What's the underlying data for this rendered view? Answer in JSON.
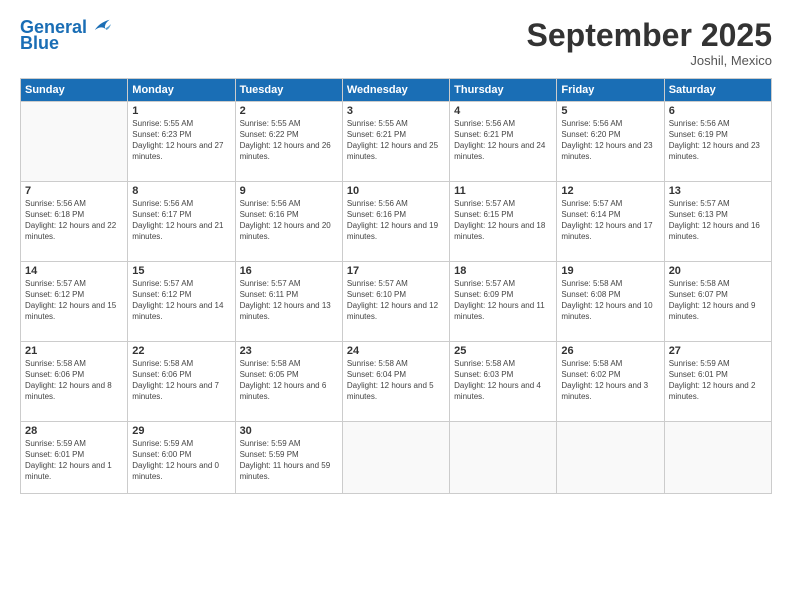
{
  "logo": {
    "text1": "General",
    "text2": "Blue"
  },
  "title": "September 2025",
  "location": "Joshil, Mexico",
  "days_header": [
    "Sunday",
    "Monday",
    "Tuesday",
    "Wednesday",
    "Thursday",
    "Friday",
    "Saturday"
  ],
  "weeks": [
    [
      {
        "day": "",
        "empty": true
      },
      {
        "day": "1",
        "sunrise": "Sunrise: 5:55 AM",
        "sunset": "Sunset: 6:23 PM",
        "daylight": "Daylight: 12 hours and 27 minutes."
      },
      {
        "day": "2",
        "sunrise": "Sunrise: 5:55 AM",
        "sunset": "Sunset: 6:22 PM",
        "daylight": "Daylight: 12 hours and 26 minutes."
      },
      {
        "day": "3",
        "sunrise": "Sunrise: 5:55 AM",
        "sunset": "Sunset: 6:21 PM",
        "daylight": "Daylight: 12 hours and 25 minutes."
      },
      {
        "day": "4",
        "sunrise": "Sunrise: 5:56 AM",
        "sunset": "Sunset: 6:21 PM",
        "daylight": "Daylight: 12 hours and 24 minutes."
      },
      {
        "day": "5",
        "sunrise": "Sunrise: 5:56 AM",
        "sunset": "Sunset: 6:20 PM",
        "daylight": "Daylight: 12 hours and 23 minutes."
      },
      {
        "day": "6",
        "sunrise": "Sunrise: 5:56 AM",
        "sunset": "Sunset: 6:19 PM",
        "daylight": "Daylight: 12 hours and 23 minutes."
      }
    ],
    [
      {
        "day": "7",
        "sunrise": "Sunrise: 5:56 AM",
        "sunset": "Sunset: 6:18 PM",
        "daylight": "Daylight: 12 hours and 22 minutes."
      },
      {
        "day": "8",
        "sunrise": "Sunrise: 5:56 AM",
        "sunset": "Sunset: 6:17 PM",
        "daylight": "Daylight: 12 hours and 21 minutes."
      },
      {
        "day": "9",
        "sunrise": "Sunrise: 5:56 AM",
        "sunset": "Sunset: 6:16 PM",
        "daylight": "Daylight: 12 hours and 20 minutes."
      },
      {
        "day": "10",
        "sunrise": "Sunrise: 5:56 AM",
        "sunset": "Sunset: 6:16 PM",
        "daylight": "Daylight: 12 hours and 19 minutes."
      },
      {
        "day": "11",
        "sunrise": "Sunrise: 5:57 AM",
        "sunset": "Sunset: 6:15 PM",
        "daylight": "Daylight: 12 hours and 18 minutes."
      },
      {
        "day": "12",
        "sunrise": "Sunrise: 5:57 AM",
        "sunset": "Sunset: 6:14 PM",
        "daylight": "Daylight: 12 hours and 17 minutes."
      },
      {
        "day": "13",
        "sunrise": "Sunrise: 5:57 AM",
        "sunset": "Sunset: 6:13 PM",
        "daylight": "Daylight: 12 hours and 16 minutes."
      }
    ],
    [
      {
        "day": "14",
        "sunrise": "Sunrise: 5:57 AM",
        "sunset": "Sunset: 6:12 PM",
        "daylight": "Daylight: 12 hours and 15 minutes."
      },
      {
        "day": "15",
        "sunrise": "Sunrise: 5:57 AM",
        "sunset": "Sunset: 6:12 PM",
        "daylight": "Daylight: 12 hours and 14 minutes."
      },
      {
        "day": "16",
        "sunrise": "Sunrise: 5:57 AM",
        "sunset": "Sunset: 6:11 PM",
        "daylight": "Daylight: 12 hours and 13 minutes."
      },
      {
        "day": "17",
        "sunrise": "Sunrise: 5:57 AM",
        "sunset": "Sunset: 6:10 PM",
        "daylight": "Daylight: 12 hours and 12 minutes."
      },
      {
        "day": "18",
        "sunrise": "Sunrise: 5:57 AM",
        "sunset": "Sunset: 6:09 PM",
        "daylight": "Daylight: 12 hours and 11 minutes."
      },
      {
        "day": "19",
        "sunrise": "Sunrise: 5:58 AM",
        "sunset": "Sunset: 6:08 PM",
        "daylight": "Daylight: 12 hours and 10 minutes."
      },
      {
        "day": "20",
        "sunrise": "Sunrise: 5:58 AM",
        "sunset": "Sunset: 6:07 PM",
        "daylight": "Daylight: 12 hours and 9 minutes."
      }
    ],
    [
      {
        "day": "21",
        "sunrise": "Sunrise: 5:58 AM",
        "sunset": "Sunset: 6:06 PM",
        "daylight": "Daylight: 12 hours and 8 minutes."
      },
      {
        "day": "22",
        "sunrise": "Sunrise: 5:58 AM",
        "sunset": "Sunset: 6:06 PM",
        "daylight": "Daylight: 12 hours and 7 minutes."
      },
      {
        "day": "23",
        "sunrise": "Sunrise: 5:58 AM",
        "sunset": "Sunset: 6:05 PM",
        "daylight": "Daylight: 12 hours and 6 minutes."
      },
      {
        "day": "24",
        "sunrise": "Sunrise: 5:58 AM",
        "sunset": "Sunset: 6:04 PM",
        "daylight": "Daylight: 12 hours and 5 minutes."
      },
      {
        "day": "25",
        "sunrise": "Sunrise: 5:58 AM",
        "sunset": "Sunset: 6:03 PM",
        "daylight": "Daylight: 12 hours and 4 minutes."
      },
      {
        "day": "26",
        "sunrise": "Sunrise: 5:58 AM",
        "sunset": "Sunset: 6:02 PM",
        "daylight": "Daylight: 12 hours and 3 minutes."
      },
      {
        "day": "27",
        "sunrise": "Sunrise: 5:59 AM",
        "sunset": "Sunset: 6:01 PM",
        "daylight": "Daylight: 12 hours and 2 minutes."
      }
    ],
    [
      {
        "day": "28",
        "sunrise": "Sunrise: 5:59 AM",
        "sunset": "Sunset: 6:01 PM",
        "daylight": "Daylight: 12 hours and 1 minute."
      },
      {
        "day": "29",
        "sunrise": "Sunrise: 5:59 AM",
        "sunset": "Sunset: 6:00 PM",
        "daylight": "Daylight: 12 hours and 0 minutes."
      },
      {
        "day": "30",
        "sunrise": "Sunrise: 5:59 AM",
        "sunset": "Sunset: 5:59 PM",
        "daylight": "Daylight: 11 hours and 59 minutes."
      },
      {
        "day": "",
        "empty": true
      },
      {
        "day": "",
        "empty": true
      },
      {
        "day": "",
        "empty": true
      },
      {
        "day": "",
        "empty": true
      }
    ]
  ]
}
